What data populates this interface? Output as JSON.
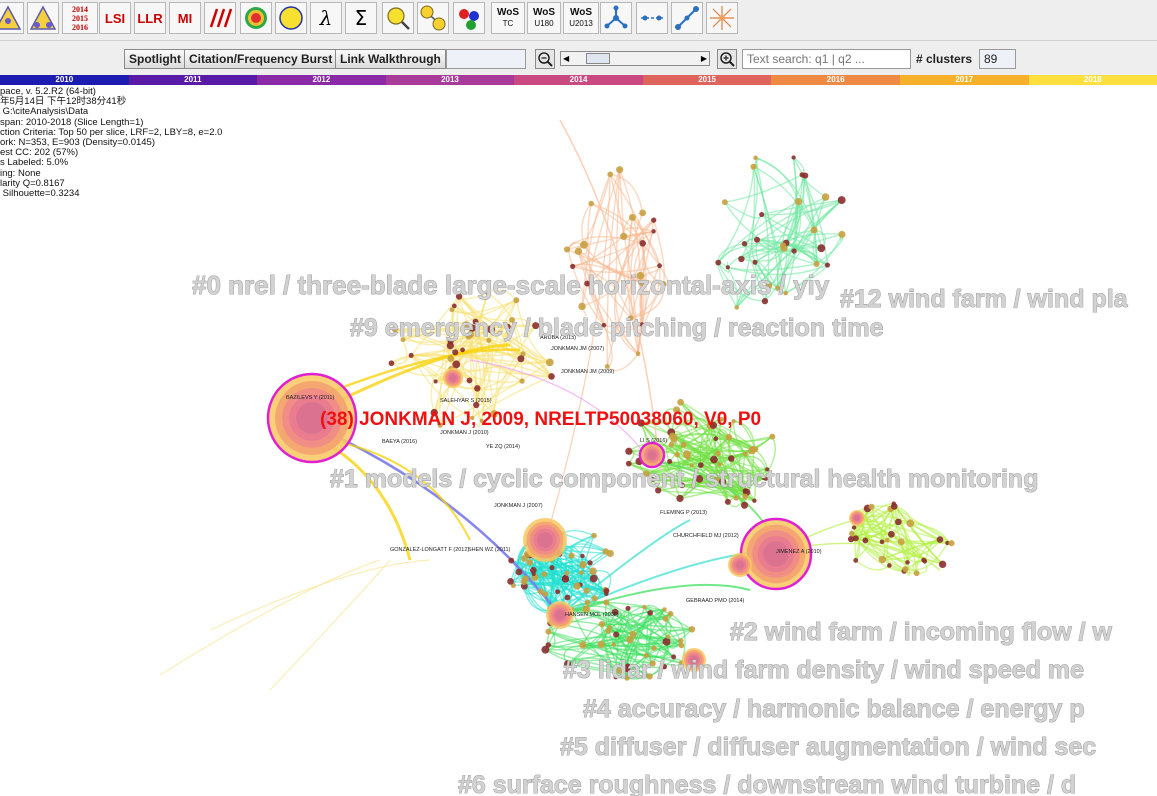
{
  "toolbar": {
    "buttons": [
      {
        "name": "cluster-view-icon",
        "text": ""
      },
      {
        "name": "triangle-view-icon",
        "text": ""
      },
      {
        "name": "timeline-years-button",
        "text": "2014\n2015\n2016"
      },
      {
        "name": "lsi-button",
        "text": "LSI"
      },
      {
        "name": "llr-button",
        "text": "LLR"
      },
      {
        "name": "mi-button",
        "text": "MI"
      },
      {
        "name": "slashes-icon",
        "text": ""
      },
      {
        "name": "ring-node-icon",
        "text": ""
      },
      {
        "name": "yellow-circle-icon",
        "text": ""
      },
      {
        "name": "lambda-icon",
        "text": "λ"
      },
      {
        "name": "sigma-icon",
        "text": "Σ"
      },
      {
        "name": "search-node-icon",
        "text": ""
      },
      {
        "name": "linked-nodes-icon",
        "text": ""
      },
      {
        "name": "rgb-nodes-icon",
        "text": ""
      },
      {
        "name": "wos-tc-button",
        "text": "WoS",
        "sub": "TC"
      },
      {
        "name": "wos-u180-button",
        "text": "WoS",
        "sub": "U180"
      },
      {
        "name": "wos-u2013-button",
        "text": "WoS",
        "sub": "U2013"
      },
      {
        "name": "network-icon",
        "text": ""
      },
      {
        "name": "dotted-line-icon",
        "text": ""
      },
      {
        "name": "link-line-icon",
        "text": ""
      },
      {
        "name": "starburst-icon",
        "text": ""
      }
    ],
    "year_lines": [
      "2014",
      "2015",
      "2016"
    ],
    "lsi": "LSI",
    "llr": "LLR",
    "mi": "MI",
    "lambda": "λ",
    "sigma": "Σ",
    "wos": "WoS",
    "wos_tc": "TC",
    "wos_u180": "U180",
    "wos_u2013": "U2013"
  },
  "controls": {
    "spotlight": "Spotlight",
    "burst": "Citation/Frequency Burst",
    "walkthrough": "Link Walkthrough",
    "blank_field": "",
    "search_placeholder": "Text search: q1 | q2 ...",
    "clusters_label": "# clusters",
    "clusters_value": "89"
  },
  "timeline": {
    "years": [
      "2010",
      "2011",
      "2012",
      "2013",
      "2014",
      "2015",
      "2016",
      "2017",
      "2018"
    ],
    "colors": [
      "#1c1cb0",
      "#5a1aa8",
      "#8a2aa6",
      "#a83a9a",
      "#c94a80",
      "#e0645e",
      "#ee8a44",
      "#f6b02a",
      "#ffe040"
    ]
  },
  "info_lines": [
    "pace, v. 5.2.R2 (64-bit)",
    "年5月14日 下午12时38分41秒",
    " G:\\citeAnalysis\\Data",
    "span: 2010-2018 (Slice Length=1)",
    "ction Criteria: Top 50 per slice, LRF=2, LBY=8, e=2.0",
    "ork: N=353, E=903 (Density=0.0145)",
    "est CC: 202 (57%)",
    "s Labeled: 5.0%",
    "ing: None",
    "larity Q=0.8167",
    " Silhouette=0.3234"
  ],
  "highlight_label": "(38) JONKMAN J, 2009, NRELTP50038060, V0, P0",
  "cluster_labels": [
    {
      "id": "c0",
      "text": "#0 nrel / three-blade large-scale horizontal-axis / yiy"
    },
    {
      "id": "c12",
      "text": "#12 wind farm / wind pla"
    },
    {
      "id": "c9",
      "text": "#9 emergency / blade pitching / reaction time"
    },
    {
      "id": "c1",
      "text": "#1 models / cyclic component / structural health monitoring"
    },
    {
      "id": "c2",
      "text": "#2 wind farm / incoming flow / w"
    },
    {
      "id": "c3",
      "text": "#3 lidar / wind farm density / wind speed me"
    },
    {
      "id": "c4",
      "text": "#4 accuracy / harmonic balance / energy p"
    },
    {
      "id": "c5",
      "text": "#5 diffuser / diffuser augmentation / wind sec"
    },
    {
      "id": "c6",
      "text": "#6 surface roughness / downstream wind turbine / d"
    }
  ],
  "node_labels": [
    {
      "text": "BAZILEVS Y (2011)"
    },
    {
      "text": "JONKMAN JM (2007)"
    },
    {
      "text": "JONKMAN JM (2009)"
    },
    {
      "text": "SALEHYAR S (2015)"
    },
    {
      "text": "JONKMAN J (2010)"
    },
    {
      "text": "BAEYA (2016)"
    },
    {
      "text": "YE ZQ (2014)"
    },
    {
      "text": "LI S (2016)"
    },
    {
      "text": "JONKMAN J (2007)"
    },
    {
      "text": "FLEMING P (2013)"
    },
    {
      "text": "CHURCHFIELD MJ (2012)"
    },
    {
      "text": "JIMENEZ A (2010)"
    },
    {
      "text": "GONZALEZ-LONGATT F (2012)"
    },
    {
      "text": "SHEN WZ (2011)"
    },
    {
      "text": "HANSEN MOL (2008)"
    },
    {
      "text": "GEBRAAD PMO (2014)"
    },
    {
      "text": "ARUBA (2013)"
    }
  ]
}
